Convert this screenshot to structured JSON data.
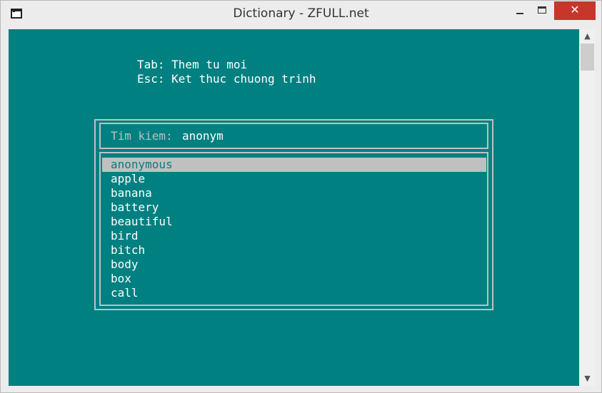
{
  "window": {
    "title": "Dictionary - ZFULL.net",
    "close_symbol": "✕"
  },
  "console": {
    "hints": [
      "Tab: Them tu moi",
      "Esc: Ket thuc chuong trinh"
    ],
    "search": {
      "label": "Tim kiem:",
      "value": "anonym"
    },
    "words": [
      "anonymous",
      "apple",
      "banana",
      "battery",
      "beautiful",
      "bird",
      "bitch",
      "body",
      "box",
      "call"
    ],
    "selected_index": 0,
    "colors": {
      "background": "#008080",
      "frame": "#c0c0c0",
      "text": "#ffffff",
      "highlight_bg": "#c0c0c0",
      "highlight_fg": "#008080"
    }
  },
  "scrollbar": {
    "up_icon": "▲",
    "down_icon": "▼"
  }
}
